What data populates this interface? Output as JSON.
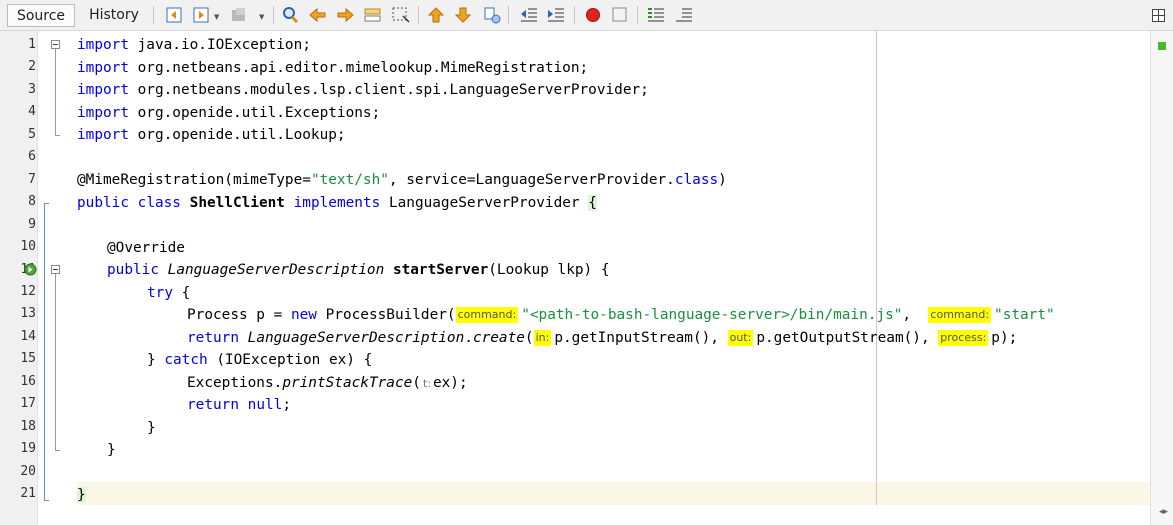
{
  "tabs": [
    {
      "label": "Source",
      "active": true
    },
    {
      "label": "History",
      "active": false
    }
  ],
  "toolbar_icons": [
    "back-icon",
    "forward-icon",
    "bookmark-icon",
    "find-icon",
    "find-previous-icon",
    "find-next-icon",
    "toggle-highlight-icon",
    "select-rectangle-icon",
    "prev-bookmark-icon",
    "next-bookmark-icon",
    "toggle-bookmark-icon",
    "shift-left-icon",
    "shift-right-icon",
    "record-macro-icon",
    "stop-macro-icon",
    "comment-icon",
    "uncomment-icon"
  ],
  "line_numbers": [
    "1",
    "2",
    "3",
    "4",
    "5",
    "6",
    "7",
    "8",
    "9",
    "10",
    "11",
    "12",
    "13",
    "14",
    "15",
    "16",
    "17",
    "18",
    "19",
    "20",
    "21"
  ],
  "code": {
    "l1": {
      "kw": "import",
      "rest": " java.io.IOException;"
    },
    "l2": {
      "kw": "import",
      "rest": " org.netbeans.api.editor.mimelookup.MimeRegistration;"
    },
    "l3": {
      "kw": "import",
      "rest": " org.netbeans.modules.lsp.client.spi.LanguageServerProvider;"
    },
    "l4": {
      "kw": "import",
      "rest": " org.openide.util.Exceptions;"
    },
    "l5": {
      "kw": "import",
      "rest": " org.openide.util.Lookup;"
    },
    "l7": {
      "a": "@MimeRegistration(mimeType=",
      "s": "\"text/sh\"",
      "b": ", service=LanguageServerProvider.",
      "kw": "class",
      "c": ")"
    },
    "l8": {
      "kw1": "public",
      "kw2": "class",
      "name": "ShellClient",
      "kw3": "implements",
      "iface": "LanguageServerProvider",
      "brace": "{"
    },
    "l10": {
      "text": "@Override"
    },
    "l11": {
      "kw": "public",
      "type": "LanguageServerDescription",
      "name": "startServer",
      "rest": "(Lookup lkp) {"
    },
    "l12": {
      "kw": "try",
      "rest": " {"
    },
    "l13": {
      "a": "Process p = ",
      "kw": "new",
      "b": " ProcessBuilder(",
      "hint1": "command:",
      "s1": "\"<path-to-bash-language-server>/bin/main.js\"",
      "c": ", ",
      "hint2": "command:",
      "s2": "\"start\""
    },
    "l14": {
      "kw": "return",
      "type": "LanguageServerDescription",
      "dot": ".",
      "method": "create",
      "paren": "(",
      "hint1": "in:",
      "a": "p.getInputStream(), ",
      "hint2": "out:",
      "b": "p.getOutputStream(), ",
      "hint3": "process:",
      "c": "p);"
    },
    "l15": {
      "a": "} ",
      "kw": "catch",
      "rest": " (IOException ex) {"
    },
    "l16": {
      "a": "Exceptions.",
      "method": "printStackTrace",
      "paren": "(",
      "hint": "t:",
      "rest": "ex);"
    },
    "l17": {
      "kw1": "return",
      "kw2": "null",
      "rest": ";"
    },
    "l18": {
      "text": "}"
    },
    "l19": {
      "text": "}"
    },
    "l21": {
      "text": "}"
    }
  },
  "colors": {
    "keyword": "#0000e6",
    "string_orange": "#ce7b00",
    "string_green": "#1a8f3c",
    "hint_bg": "#ffff00",
    "ok_mark": "#4fb52f"
  }
}
